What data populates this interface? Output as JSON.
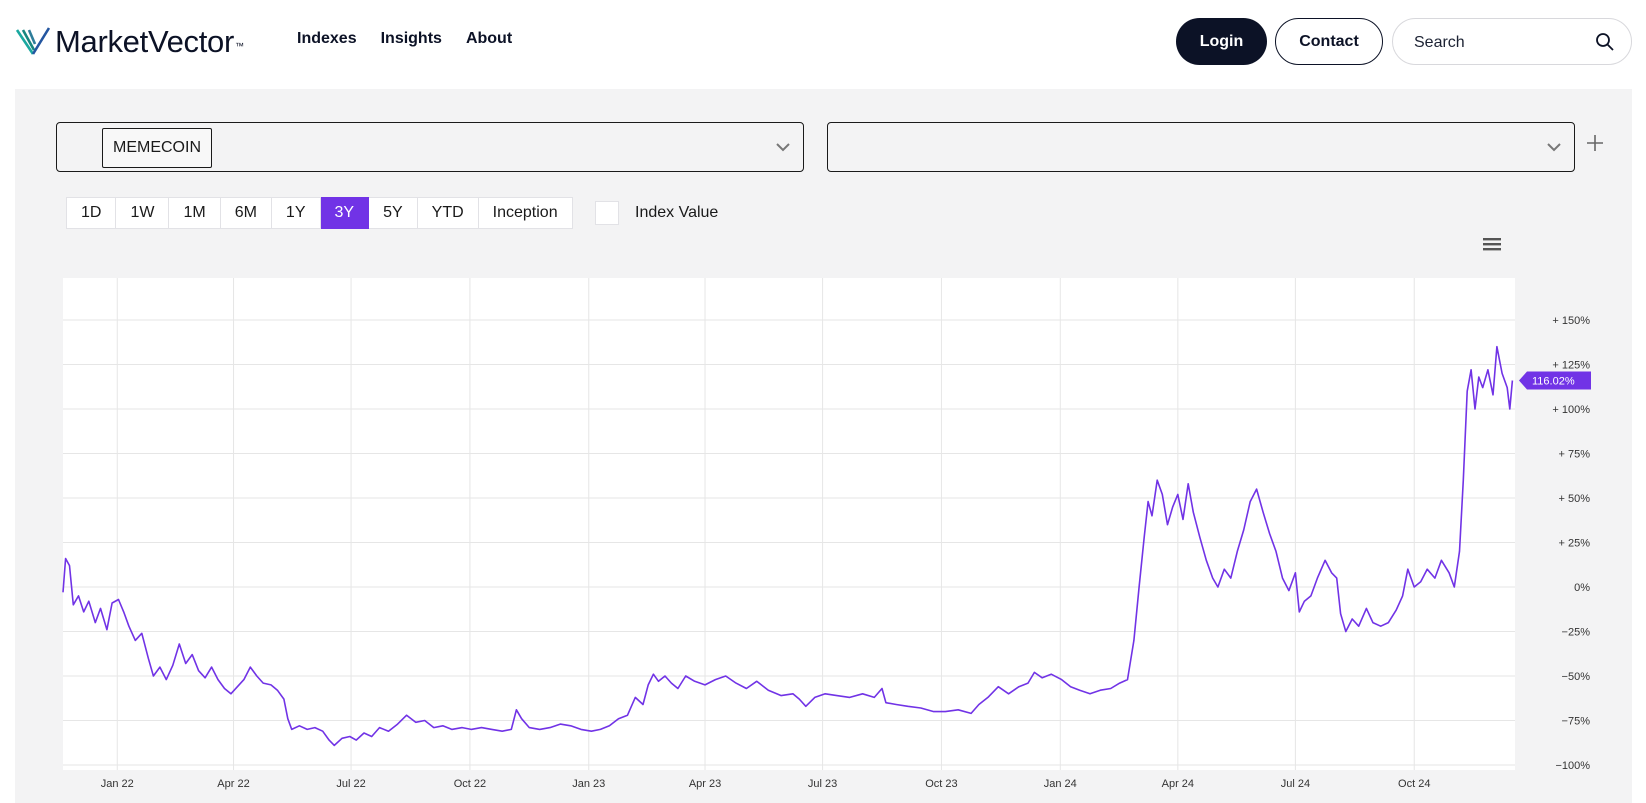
{
  "header": {
    "logo_text": "MarketVector",
    "logo_tm": "™",
    "nav": [
      "Indexes",
      "Insights",
      "About"
    ],
    "login_label": "Login",
    "contact_label": "Contact",
    "search_placeholder": "Search"
  },
  "controls": {
    "selected_index": "MEMECOIN",
    "compare_value": "",
    "ranges": [
      "1D",
      "1W",
      "1M",
      "6M",
      "1Y",
      "3Y",
      "5Y",
      "YTD",
      "Inception"
    ],
    "active_range": "3Y",
    "index_value_label": "Index Value",
    "index_value_checked": false
  },
  "colors": {
    "accent": "#7133e6",
    "navy": "#0c1226",
    "panel": "#f3f3f4"
  },
  "chart_data": {
    "type": "line",
    "title": "",
    "xlabel": "",
    "ylabel": "",
    "ylim": [
      -100,
      150
    ],
    "y_ticks": [
      {
        "v": 150,
        "label": "+ 150%"
      },
      {
        "v": 125,
        "label": "+ 125%"
      },
      {
        "v": 100,
        "label": "+ 100%"
      },
      {
        "v": 75,
        "label": "+ 75%"
      },
      {
        "v": 50,
        "label": "+ 50%"
      },
      {
        "v": 25,
        "label": "+ 25%"
      },
      {
        "v": 0,
        "label": "0%"
      },
      {
        "v": -25,
        "label": "−25%"
      },
      {
        "v": -50,
        "label": "−50%"
      },
      {
        "v": -75,
        "label": "−75%"
      },
      {
        "v": -100,
        "label": "−100%"
      }
    ],
    "x_ticks": [
      {
        "d": "2022-01-01",
        "label": "Jan 22"
      },
      {
        "d": "2022-04-01",
        "label": "Apr 22"
      },
      {
        "d": "2022-07-01",
        "label": "Jul 22"
      },
      {
        "d": "2022-10-01",
        "label": "Oct 22"
      },
      {
        "d": "2023-01-01",
        "label": "Jan 23"
      },
      {
        "d": "2023-04-01",
        "label": "Apr 23"
      },
      {
        "d": "2023-07-01",
        "label": "Jul 23"
      },
      {
        "d": "2023-10-01",
        "label": "Oct 23"
      },
      {
        "d": "2024-01-01",
        "label": "Jan 24"
      },
      {
        "d": "2024-04-01",
        "label": "Apr 24"
      },
      {
        "d": "2024-07-01",
        "label": "Jul 24"
      },
      {
        "d": "2024-10-01",
        "label": "Oct 24"
      }
    ],
    "xlim": [
      "2021-11-20",
      "2024-12-18"
    ],
    "grid": true,
    "last_value_label": "116.02%",
    "series": [
      {
        "color": "#7133e6",
        "points": [
          [
            "2021-11-20",
            -3
          ],
          [
            "2021-11-22",
            16
          ],
          [
            "2021-11-25",
            12
          ],
          [
            "2021-11-28",
            -10
          ],
          [
            "2021-12-02",
            -5
          ],
          [
            "2021-12-06",
            -14
          ],
          [
            "2021-12-10",
            -8
          ],
          [
            "2021-12-15",
            -20
          ],
          [
            "2021-12-19",
            -12
          ],
          [
            "2021-12-24",
            -24
          ],
          [
            "2021-12-28",
            -9
          ],
          [
            "2022-01-02",
            -7
          ],
          [
            "2022-01-06",
            -14
          ],
          [
            "2022-01-10",
            -22
          ],
          [
            "2022-01-15",
            -30
          ],
          [
            "2022-01-20",
            -26
          ],
          [
            "2022-01-25",
            -40
          ],
          [
            "2022-01-29",
            -50
          ],
          [
            "2022-02-03",
            -45
          ],
          [
            "2022-02-08",
            -52
          ],
          [
            "2022-02-13",
            -44
          ],
          [
            "2022-02-18",
            -32
          ],
          [
            "2022-02-23",
            -43
          ],
          [
            "2022-02-28",
            -38
          ],
          [
            "2022-03-05",
            -47
          ],
          [
            "2022-03-10",
            -51
          ],
          [
            "2022-03-15",
            -45
          ],
          [
            "2022-03-20",
            -52
          ],
          [
            "2022-03-25",
            -57
          ],
          [
            "2022-03-30",
            -60
          ],
          [
            "2022-04-04",
            -56
          ],
          [
            "2022-04-09",
            -52
          ],
          [
            "2022-04-14",
            -45
          ],
          [
            "2022-04-19",
            -50
          ],
          [
            "2022-04-24",
            -54
          ],
          [
            "2022-04-30",
            -55
          ],
          [
            "2022-05-05",
            -58
          ],
          [
            "2022-05-10",
            -63
          ],
          [
            "2022-05-13",
            -74
          ],
          [
            "2022-05-16",
            -80
          ],
          [
            "2022-05-22",
            -78
          ],
          [
            "2022-05-28",
            -80
          ],
          [
            "2022-06-03",
            -79
          ],
          [
            "2022-06-09",
            -81
          ],
          [
            "2022-06-14",
            -86
          ],
          [
            "2022-06-18",
            -89
          ],
          [
            "2022-06-24",
            -85
          ],
          [
            "2022-06-30",
            -84
          ],
          [
            "2022-07-05",
            -86
          ],
          [
            "2022-07-11",
            -82
          ],
          [
            "2022-07-17",
            -84
          ],
          [
            "2022-07-23",
            -79
          ],
          [
            "2022-07-30",
            -81
          ],
          [
            "2022-08-06",
            -77
          ],
          [
            "2022-08-13",
            -72
          ],
          [
            "2022-08-20",
            -76
          ],
          [
            "2022-08-27",
            -75
          ],
          [
            "2022-09-03",
            -79
          ],
          [
            "2022-09-10",
            -78
          ],
          [
            "2022-09-17",
            -80
          ],
          [
            "2022-09-25",
            -79
          ],
          [
            "2022-10-02",
            -80
          ],
          [
            "2022-10-10",
            -79
          ],
          [
            "2022-10-18",
            -80
          ],
          [
            "2022-10-26",
            -81
          ],
          [
            "2022-11-02",
            -80
          ],
          [
            "2022-11-06",
            -69
          ],
          [
            "2022-11-10",
            -74
          ],
          [
            "2022-11-16",
            -79
          ],
          [
            "2022-11-24",
            -80
          ],
          [
            "2022-12-02",
            -79
          ],
          [
            "2022-12-10",
            -77
          ],
          [
            "2022-12-18",
            -78
          ],
          [
            "2022-12-26",
            -80
          ],
          [
            "2023-01-03",
            -81
          ],
          [
            "2023-01-10",
            -80
          ],
          [
            "2023-01-17",
            -78
          ],
          [
            "2023-01-24",
            -74
          ],
          [
            "2023-01-31",
            -72
          ],
          [
            "2023-02-06",
            -62
          ],
          [
            "2023-02-12",
            -66
          ],
          [
            "2023-02-16",
            -55
          ],
          [
            "2023-02-20",
            -49
          ],
          [
            "2023-02-24",
            -53
          ],
          [
            "2023-03-01",
            -50
          ],
          [
            "2023-03-06",
            -54
          ],
          [
            "2023-03-11",
            -57
          ],
          [
            "2023-03-17",
            -50
          ],
          [
            "2023-03-24",
            -53
          ],
          [
            "2023-04-01",
            -55
          ],
          [
            "2023-04-09",
            -52
          ],
          [
            "2023-04-17",
            -50
          ],
          [
            "2023-04-25",
            -54
          ],
          [
            "2023-05-03",
            -57
          ],
          [
            "2023-05-11",
            -53
          ],
          [
            "2023-05-20",
            -58
          ],
          [
            "2023-05-30",
            -61
          ],
          [
            "2023-06-08",
            -60
          ],
          [
            "2023-06-13",
            -63
          ],
          [
            "2023-06-18",
            -67
          ],
          [
            "2023-06-25",
            -62
          ],
          [
            "2023-07-03",
            -60
          ],
          [
            "2023-07-12",
            -61
          ],
          [
            "2023-07-22",
            -62
          ],
          [
            "2023-08-01",
            -60
          ],
          [
            "2023-08-10",
            -62
          ],
          [
            "2023-08-16",
            -57
          ],
          [
            "2023-08-19",
            -65
          ],
          [
            "2023-08-27",
            -66
          ],
          [
            "2023-09-05",
            -67
          ],
          [
            "2023-09-15",
            -68
          ],
          [
            "2023-09-25",
            -70
          ],
          [
            "2023-10-04",
            -70
          ],
          [
            "2023-10-14",
            -69
          ],
          [
            "2023-10-24",
            -71
          ],
          [
            "2023-10-30",
            -66
          ],
          [
            "2023-11-06",
            -62
          ],
          [
            "2023-11-14",
            -56
          ],
          [
            "2023-11-22",
            -60
          ],
          [
            "2023-11-30",
            -56
          ],
          [
            "2023-12-07",
            -54
          ],
          [
            "2023-12-12",
            -48
          ],
          [
            "2023-12-18",
            -51
          ],
          [
            "2023-12-25",
            -49
          ],
          [
            "2024-01-02",
            -52
          ],
          [
            "2024-01-09",
            -56
          ],
          [
            "2024-01-16",
            -58
          ],
          [
            "2024-01-24",
            -60
          ],
          [
            "2024-02-01",
            -58
          ],
          [
            "2024-02-09",
            -57
          ],
          [
            "2024-02-16",
            -54
          ],
          [
            "2024-02-22",
            -52
          ],
          [
            "2024-02-27",
            -30
          ],
          [
            "2024-03-02",
            0
          ],
          [
            "2024-03-06",
            28
          ],
          [
            "2024-03-09",
            48
          ],
          [
            "2024-03-12",
            40
          ],
          [
            "2024-03-16",
            60
          ],
          [
            "2024-03-20",
            52
          ],
          [
            "2024-03-24",
            35
          ],
          [
            "2024-03-28",
            45
          ],
          [
            "2024-04-01",
            52
          ],
          [
            "2024-04-05",
            38
          ],
          [
            "2024-04-09",
            58
          ],
          [
            "2024-04-13",
            42
          ],
          [
            "2024-04-18",
            28
          ],
          [
            "2024-04-23",
            15
          ],
          [
            "2024-04-28",
            5
          ],
          [
            "2024-05-02",
            0
          ],
          [
            "2024-05-07",
            10
          ],
          [
            "2024-05-12",
            5
          ],
          [
            "2024-05-17",
            20
          ],
          [
            "2024-05-22",
            32
          ],
          [
            "2024-05-27",
            48
          ],
          [
            "2024-06-01",
            55
          ],
          [
            "2024-06-06",
            42
          ],
          [
            "2024-06-11",
            30
          ],
          [
            "2024-06-16",
            20
          ],
          [
            "2024-06-21",
            5
          ],
          [
            "2024-06-26",
            -2
          ],
          [
            "2024-07-01",
            8
          ],
          [
            "2024-07-04",
            -14
          ],
          [
            "2024-07-08",
            -8
          ],
          [
            "2024-07-13",
            -5
          ],
          [
            "2024-07-18",
            5
          ],
          [
            "2024-07-24",
            15
          ],
          [
            "2024-07-29",
            8
          ],
          [
            "2024-08-02",
            5
          ],
          [
            "2024-08-05",
            -15
          ],
          [
            "2024-08-09",
            -25
          ],
          [
            "2024-08-14",
            -18
          ],
          [
            "2024-08-19",
            -22
          ],
          [
            "2024-08-25",
            -12
          ],
          [
            "2024-08-30",
            -20
          ],
          [
            "2024-09-05",
            -22
          ],
          [
            "2024-09-11",
            -20
          ],
          [
            "2024-09-17",
            -13
          ],
          [
            "2024-09-22",
            -5
          ],
          [
            "2024-09-26",
            10
          ],
          [
            "2024-10-01",
            0
          ],
          [
            "2024-10-06",
            3
          ],
          [
            "2024-10-11",
            10
          ],
          [
            "2024-10-17",
            5
          ],
          [
            "2024-10-22",
            15
          ],
          [
            "2024-10-28",
            8
          ],
          [
            "2024-11-01",
            0
          ],
          [
            "2024-11-05",
            20
          ],
          [
            "2024-11-08",
            60
          ],
          [
            "2024-11-11",
            110
          ],
          [
            "2024-11-14",
            122
          ],
          [
            "2024-11-17",
            100
          ],
          [
            "2024-11-20",
            118
          ],
          [
            "2024-11-23",
            112
          ],
          [
            "2024-11-27",
            122
          ],
          [
            "2024-12-01",
            108
          ],
          [
            "2024-12-04",
            135
          ],
          [
            "2024-12-08",
            120
          ],
          [
            "2024-12-12",
            112
          ],
          [
            "2024-12-14",
            100
          ],
          [
            "2024-12-16",
            116
          ]
        ]
      }
    ]
  }
}
